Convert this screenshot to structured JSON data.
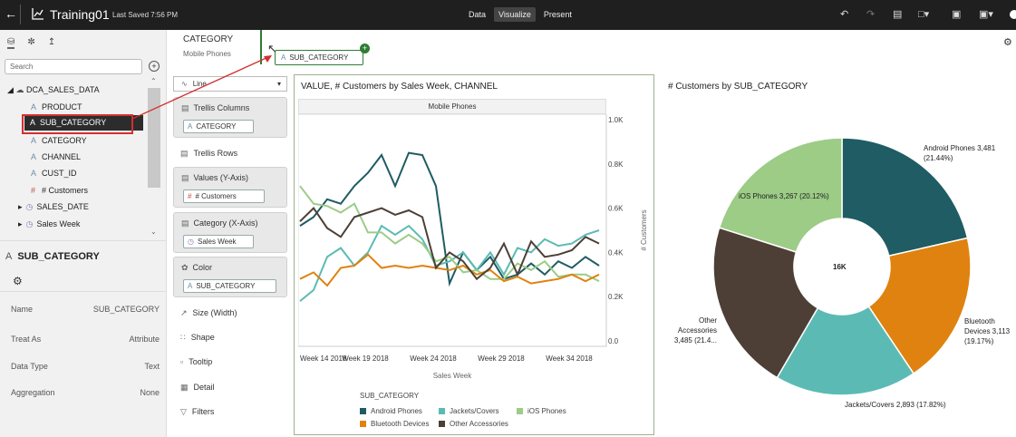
{
  "topbar": {
    "back_icon": "arrow-left-icon",
    "app_icon": "line-chart-icon",
    "title": "Training01",
    "saved": "Last Saved 7:56 PM",
    "tabs": [
      {
        "label": "Data",
        "active": false
      },
      {
        "label": "Visualize",
        "active": true
      },
      {
        "label": "Present",
        "active": false
      }
    ],
    "tool_icons": [
      "undo-icon",
      "redo-icon",
      "data-refresh-icon",
      "comment-icon",
      "preview-icon",
      "save-icon"
    ]
  },
  "leftpanel": {
    "search_placeholder": "Search",
    "tree_root": "DCA_SALES_DATA",
    "items": [
      {
        "label": "PRODUCT",
        "type": "attr"
      },
      {
        "label": "SUB_CATEGORY",
        "type": "attr",
        "selected": true
      },
      {
        "label": "CATEGORY",
        "type": "attr"
      },
      {
        "label": "CHANNEL",
        "type": "attr"
      },
      {
        "label": "CUST_ID",
        "type": "attr"
      },
      {
        "label": "# Customers",
        "type": "measure"
      },
      {
        "label": "SALES_DATE",
        "type": "time"
      },
      {
        "label": "Sales Week",
        "type": "time"
      }
    ],
    "props_title": "SUB_CATEGORY",
    "props": [
      {
        "label": "Name",
        "value": "SUB_CATEGORY"
      },
      {
        "label": "Treat As",
        "value": "Attribute"
      },
      {
        "label": "Data Type",
        "value": "Text"
      },
      {
        "label": "Aggregation",
        "value": "None"
      }
    ]
  },
  "filter": {
    "title": "CATEGORY",
    "value": "Mobile Phones",
    "drag_pill": "SUB_CATEGORY"
  },
  "grammar": {
    "chart_type": "Line",
    "trellis_columns": {
      "label": "Trellis Columns",
      "pill": "CATEGORY"
    },
    "trellis_rows": "Trellis Rows",
    "values": {
      "label": "Values (Y-Axis)",
      "pill": "# Customers"
    },
    "category": {
      "label": "Category (X-Axis)",
      "pill": "Sales Week"
    },
    "color": {
      "label": "Color",
      "pill": "SUB_CATEGORY"
    },
    "size": "Size (Width)",
    "shape": "Shape",
    "tooltip": "Tooltip",
    "detail": "Detail",
    "filters": "Filters"
  },
  "colors": {
    "android": "#1f5c63",
    "jackets": "#5bbbb4",
    "ios": "#9ccc86",
    "bluetooth": "#e0820f",
    "other": "#4d3f36"
  },
  "chart_data": [
    {
      "type": "line",
      "title": "VALUE, # Customers by Sales Week, CHANNEL",
      "facet": "Mobile Phones",
      "xlabel": "Sales Week",
      "ylabel": "# Customers",
      "tick_labels_x": [
        "Week 14 2018",
        "Week 19 2018",
        "Week 24 2018",
        "Week 29 2018",
        "Week 34 2018"
      ],
      "tick_labels_y": [
        "0.0",
        "0.2K",
        "0.4K",
        "0.6K",
        "0.8K",
        "1.0K"
      ],
      "ylim": [
        0,
        1000
      ],
      "legend_title": "SUB_CATEGORY",
      "series": [
        {
          "name": "Android Phones",
          "values": [
            520,
            560,
            640,
            620,
            700,
            760,
            840,
            700,
            850,
            840,
            700,
            260,
            400,
            320,
            380,
            280,
            300,
            350,
            300,
            360,
            330,
            380,
            340
          ]
        },
        {
          "name": "Jackets/Covers",
          "values": [
            180,
            230,
            380,
            420,
            340,
            400,
            520,
            480,
            520,
            460,
            340,
            360,
            400,
            320,
            400,
            300,
            420,
            400,
            460,
            430,
            440,
            480,
            500
          ]
        },
        {
          "name": "iOS Phones",
          "values": [
            700,
            620,
            610,
            580,
            620,
            490,
            490,
            440,
            480,
            440,
            360,
            380,
            310,
            320,
            280,
            280,
            350,
            320,
            360,
            290,
            300,
            300,
            270
          ]
        },
        {
          "name": "Bluetooth Devices",
          "values": [
            280,
            310,
            250,
            330,
            340,
            390,
            330,
            340,
            330,
            340,
            330,
            320,
            340,
            300,
            320,
            270,
            290,
            260,
            270,
            280,
            300,
            270,
            300
          ]
        },
        {
          "name": "Other Accessories",
          "values": [
            540,
            600,
            510,
            470,
            560,
            580,
            600,
            570,
            590,
            560,
            330,
            400,
            360,
            280,
            330,
            440,
            300,
            450,
            380,
            390,
            410,
            470,
            440
          ]
        }
      ]
    },
    {
      "type": "pie",
      "title": "# Customers by SUB_CATEGORY",
      "center_label": "16K",
      "slices": [
        {
          "name": "Android Phones",
          "value": 3481,
          "label": "Android Phones 3,481",
          "pct": "(21.44%)"
        },
        {
          "name": "Bluetooth Devices",
          "value": 3113,
          "label": "Bluetooth Devices 3,113",
          "pct": "(19.17%)"
        },
        {
          "name": "Jackets/Covers",
          "value": 2893,
          "label": "Jackets/Covers 2,893",
          "pct": "(17.82%)"
        },
        {
          "name": "Other Accessories",
          "value": 3485,
          "label": "Other Accessories 3,485",
          "pct": "(21.4..."
        },
        {
          "name": "iOS Phones",
          "value": 3267,
          "label": "iOS Phones 3,267",
          "pct": "(20.12%)"
        }
      ]
    }
  ]
}
